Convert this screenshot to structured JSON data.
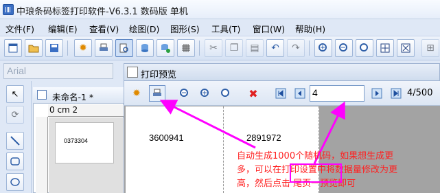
{
  "window": {
    "title": "中琅条码标签打印软件-V6.3.1 数码版 单机"
  },
  "menu": [
    {
      "label": "文件(F)"
    },
    {
      "label": "编辑(E)"
    },
    {
      "label": "查看(V)"
    },
    {
      "label": "绘图(D)"
    },
    {
      "label": "图形(S)"
    },
    {
      "label": "工具(T)"
    },
    {
      "label": "窗口(W)"
    },
    {
      "label": "帮助(H)"
    }
  ],
  "font_box": {
    "value": "Arial"
  },
  "document": {
    "tab_title": "未命名-1 *",
    "ruler_label": "0 cm 2",
    "barcode_text": "0373304"
  },
  "preview": {
    "title": "打印预览",
    "page_input": "4",
    "page_count": "4/500",
    "cells": [
      "3600941",
      "2891972"
    ]
  },
  "annotation": {
    "line1": "自动生成1000个随机码，如果想生成更",
    "line2_a": "多，可以在",
    "line2_hl": "打印设置",
    "line2_b": "中将数据量修改为更",
    "line3": "高，然后点击 尾页一预览即可"
  },
  "colors": {
    "annotation_red": "#ff2020",
    "arrow_magenta": "#ff00ff"
  }
}
